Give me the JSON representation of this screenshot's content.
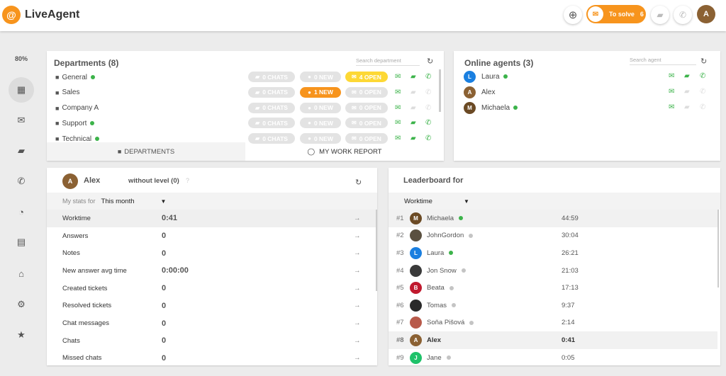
{
  "header": {
    "logo_text": "LiveAgent",
    "to_solve_label": "To solve",
    "to_solve_count": "6",
    "user_initial": "A",
    "brand_color": "#f7941d"
  },
  "sidebar": {
    "zoom": "80%",
    "items": [
      {
        "icon": "dashboard-icon",
        "glyph": "▦",
        "active": true
      },
      {
        "icon": "mail-icon",
        "glyph": "✉"
      },
      {
        "icon": "chat-icon",
        "glyph": "▰"
      },
      {
        "icon": "phone-icon",
        "glyph": "✆"
      },
      {
        "icon": "reports-icon",
        "glyph": "◔"
      },
      {
        "icon": "contacts-icon",
        "glyph": "▤"
      },
      {
        "icon": "knowledgebase-icon",
        "glyph": "⌂"
      },
      {
        "icon": "settings-icon",
        "glyph": "⚙"
      },
      {
        "icon": "star-icon",
        "glyph": "★"
      }
    ]
  },
  "departments": {
    "title": "Departments (8)",
    "search_placeholder": "Search department",
    "rows": [
      {
        "name": "General",
        "online": true,
        "chats": "0 CHATS",
        "new": "0 NEW",
        "open": "4 OPEN",
        "new_active": false,
        "open_active": true,
        "chat_on": true,
        "call_on": true
      },
      {
        "name": "Sales",
        "online": false,
        "chats": "0 CHATS",
        "new": "1 NEW",
        "open": "0 OPEN",
        "new_active": true,
        "open_active": false,
        "chat_on": false,
        "call_on": false
      },
      {
        "name": "Company A",
        "online": false,
        "chats": "0 CHATS",
        "new": "0 NEW",
        "open": "0 OPEN",
        "new_active": false,
        "open_active": false,
        "chat_on": false,
        "call_on": false
      },
      {
        "name": "Support",
        "online": true,
        "chats": "0 CHATS",
        "new": "0 NEW",
        "open": "0 OPEN",
        "new_active": false,
        "open_active": false,
        "chat_on": true,
        "call_on": true
      },
      {
        "name": "Technical",
        "online": true,
        "chats": "0 CHATS",
        "new": "0 NEW",
        "open": "0 OPEN",
        "new_active": false,
        "open_active": false,
        "chat_on": true,
        "call_on": true
      }
    ],
    "tabs": [
      "DEPARTMENTS",
      "MY WORK REPORT"
    ]
  },
  "online_agents": {
    "title": "Online agents (3)",
    "search_placeholder": "Search agent",
    "agents": [
      {
        "initial": "L",
        "name": "Laura",
        "color": "#1a7fe0",
        "online": true,
        "chat_on": true,
        "call_on": true
      },
      {
        "initial": "A",
        "name": "Alex",
        "color": "#8b6133",
        "online": false,
        "chat_on": false,
        "call_on": false
      },
      {
        "initial": "M",
        "name": "Michaela",
        "color": "#6b4a24",
        "online": true,
        "chat_on": false,
        "call_on": false
      }
    ]
  },
  "stats": {
    "user_initial": "A",
    "user_name": "Alex",
    "level": "without level (0)",
    "help": "?",
    "period_label": "My stats for",
    "period_value": "This month",
    "rows": [
      {
        "label": "Worktime",
        "value": "0:41"
      },
      {
        "label": "Answers",
        "value": "0"
      },
      {
        "label": "Notes",
        "value": "0"
      },
      {
        "label": "New answer avg time",
        "value": "0:00:00"
      },
      {
        "label": "Created tickets",
        "value": "0"
      },
      {
        "label": "Resolved tickets",
        "value": "0"
      },
      {
        "label": "Chat messages",
        "value": "0"
      },
      {
        "label": "Chats",
        "value": "0"
      },
      {
        "label": "Missed chats",
        "value": "0"
      }
    ]
  },
  "leaderboard": {
    "title": "Leaderboard for",
    "metric": "Worktime",
    "rows": [
      {
        "rank": "#1",
        "initial": "M",
        "name": "Michaela",
        "color": "#6b4a24",
        "online": true,
        "time": "44:59"
      },
      {
        "rank": "#2",
        "initial": "",
        "name": "JohnGordon",
        "color": "#5a5040",
        "online": false,
        "time": "30:04"
      },
      {
        "rank": "#3",
        "initial": "L",
        "name": "Laura",
        "color": "#1a7fe0",
        "online": true,
        "time": "26:21"
      },
      {
        "rank": "#4",
        "initial": "",
        "name": "Jon Snow",
        "color": "#3a3a3a",
        "online": false,
        "time": "21:03"
      },
      {
        "rank": "#5",
        "initial": "B",
        "name": "Beata",
        "color": "#c0192e",
        "online": false,
        "time": "17:13"
      },
      {
        "rank": "#6",
        "initial": "",
        "name": "Tomas",
        "color": "#2a2a2a",
        "online": false,
        "time": "9:37"
      },
      {
        "rank": "#7",
        "initial": "",
        "name": "Soňa Pišová",
        "color": "#b85a4a",
        "online": false,
        "time": "2:14"
      },
      {
        "rank": "#8",
        "initial": "A",
        "name": "Alex",
        "color": "#8b6133",
        "online": false,
        "time": "0:41",
        "current": true
      },
      {
        "rank": "#9",
        "initial": "J",
        "name": "Jane",
        "color": "#1fc26a",
        "online": false,
        "time": "0:05"
      }
    ]
  },
  "colors": {
    "online": "#3cb34a",
    "offline": "#c4c4c4",
    "open_badge": "#fdd835",
    "new_badge": "#f7941d",
    "icon_green": "#3cb34a",
    "icon_gray": "#e3e3e3"
  }
}
